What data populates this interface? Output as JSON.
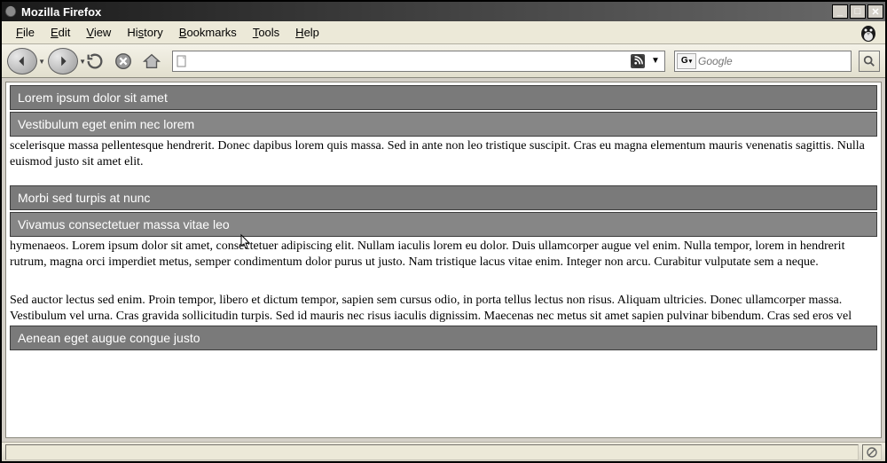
{
  "window": {
    "title": "Mozilla Firefox"
  },
  "menu": {
    "file": {
      "label": "File",
      "accel": "F"
    },
    "edit": {
      "label": "Edit",
      "accel": "E"
    },
    "view": {
      "label": "View",
      "accel": "V"
    },
    "history": {
      "label": "History",
      "accel": "s"
    },
    "bookmarks": {
      "label": "Bookmarks",
      "accel": "B"
    },
    "tools": {
      "label": "Tools",
      "accel": "T"
    },
    "help": {
      "label": "Help",
      "accel": "H"
    }
  },
  "toolbar": {
    "url_value": "",
    "search_placeholder": "Google",
    "search_engine_label": "G"
  },
  "page": {
    "h1": "Lorem ipsum dolor sit amet",
    "h2": "Vestibulum eget enim nec lorem",
    "p1": "scelerisque massa pellentesque hendrerit. Donec dapibus lorem quis massa. Sed in ante non leo tristique suscipit. Cras eu magna elementum mauris venenatis sagittis. Nulla euismod justo sit amet elit.",
    "h3": "Morbi sed turpis at nunc",
    "h4": "Vivamus consectetuer massa vitae leo",
    "p2": "hymenaeos. Lorem ipsum dolor sit amet, consectetuer adipiscing elit. Nullam iaculis lorem eu dolor. Duis ullamcorper augue vel enim. Nulla tempor, lorem in hendrerit rutrum, magna orci imperdiet metus, semper condimentum dolor purus ut justo. Nam tristique lacus vitae enim. Integer non arcu. Curabitur vulputate sem a neque.",
    "p3": "Sed auctor lectus sed enim. Proin tempor, libero et dictum tempor, sapien sem cursus odio, in porta tellus lectus non risus. Aliquam ultricies. Donec ullamcorper massa. Vestibulum vel urna. Cras gravida sollicitudin turpis. Sed id mauris nec risus iaculis dignissim. Maecenas nec metus sit amet sapien pulvinar bibendum. Cras sed eros vel",
    "h5": "Aenean eget augue congue justo"
  }
}
